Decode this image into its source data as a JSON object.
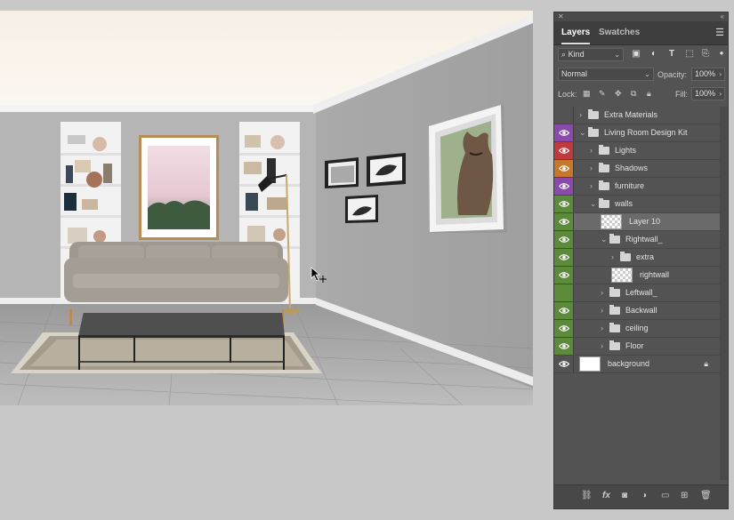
{
  "canvas": {
    "description_icon": "room-mockup-canvas"
  },
  "panel": {
    "collapse_icons": [
      "close-panel-icon",
      "collapse-icon"
    ],
    "tabs": [
      {
        "label": "Layers",
        "active": true
      },
      {
        "label": "Swatches",
        "active": false
      }
    ],
    "filter": {
      "kind_label": "Kind"
    },
    "blend": {
      "mode": "Normal",
      "opacity_label": "Opacity:",
      "opacity_value": "100%"
    },
    "lock": {
      "lock_label": "Lock:",
      "fill_label": "Fill:",
      "fill_value": "100%"
    },
    "layers": [
      {
        "name": "Extra Materials",
        "indent": 0,
        "type": "folder",
        "eye_color": null,
        "visible": false,
        "expanded": false
      },
      {
        "name": "Living Room Design Kit",
        "indent": 0,
        "type": "folder",
        "eye_color": "#8a4aab",
        "visible": true,
        "expanded": true
      },
      {
        "name": "Lights",
        "indent": 1,
        "type": "folder",
        "eye_color": "#c0393c",
        "visible": true,
        "expanded": false
      },
      {
        "name": "Shadows",
        "indent": 1,
        "type": "folder",
        "eye_color": "#c7782a",
        "visible": true,
        "expanded": false
      },
      {
        "name": "furniture",
        "indent": 1,
        "type": "folder",
        "eye_color": "#8a4aab",
        "visible": true,
        "expanded": false
      },
      {
        "name": "walls",
        "indent": 1,
        "type": "folder",
        "eye_color": "#5b8a3a",
        "visible": true,
        "expanded": true
      },
      {
        "name": "Layer 10",
        "indent": 2,
        "type": "smart",
        "eye_color": "#5b8a3a",
        "visible": true,
        "selected": true
      },
      {
        "name": "Rightwall_",
        "indent": 2,
        "type": "folder",
        "eye_color": "#5b8a3a",
        "visible": true,
        "expanded": true
      },
      {
        "name": "extra",
        "indent": 3,
        "type": "folder",
        "eye_color": "#5b8a3a",
        "visible": true,
        "expanded": false
      },
      {
        "name": "rightwall",
        "indent": 3,
        "type": "smart",
        "eye_color": "#5b8a3a",
        "visible": true
      },
      {
        "name": "Leftwall_",
        "indent": 2,
        "type": "folder",
        "eye_color": "#5b8a3a",
        "visible": false,
        "expanded": false
      },
      {
        "name": "Backwall",
        "indent": 2,
        "type": "folder",
        "eye_color": "#5b8a3a",
        "visible": true,
        "expanded": false
      },
      {
        "name": "ceiling",
        "indent": 2,
        "type": "folder",
        "eye_color": "#5b8a3a",
        "visible": true,
        "expanded": false
      },
      {
        "name": "Floor",
        "indent": 2,
        "type": "folder",
        "eye_color": "#5b8a3a",
        "visible": true,
        "expanded": false
      },
      {
        "name": "background",
        "indent": 0,
        "type": "pixel",
        "eye_color": null,
        "visible": true,
        "locked": true
      }
    ],
    "bottom_icons": [
      "link-icon",
      "fx-icon",
      "mask-icon",
      "adjustment-icon",
      "new-group-icon",
      "new-layer-icon",
      "trash-icon"
    ],
    "fx_label": "fx"
  }
}
